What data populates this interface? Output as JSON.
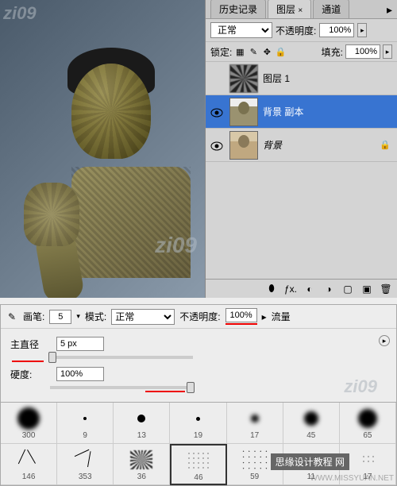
{
  "canvas": {
    "wm_top": "zi09",
    "wm_bottom": "zi09"
  },
  "panels": {
    "tabs": {
      "history": "历史记录",
      "layers": "图层",
      "channels": "通道",
      "close": "×"
    }
  },
  "blend": {
    "mode": "正常",
    "opacity_label": "不透明度:",
    "opacity": "100%",
    "arrow": "▸"
  },
  "lock": {
    "label": "锁定:",
    "fill_label": "填充:",
    "fill": "100%"
  },
  "layers": [
    {
      "name": "图层 1",
      "visible": false,
      "locked": false
    },
    {
      "name": "背景 副本",
      "visible": true,
      "locked": false
    },
    {
      "name": "背景",
      "visible": true,
      "locked": true
    }
  ],
  "brush_bar": {
    "brush_label": "画笔:",
    "brush_size": "5",
    "mode_label": "模式:",
    "mode": "正常",
    "opacity_label": "不透明度:",
    "opacity": "100%",
    "flow_label": "流量",
    "arrow": "▸"
  },
  "brush_ctrl": {
    "diameter_label": "主直径",
    "diameter": "5 px",
    "hardness_label": "硬度:",
    "hardness": "100%",
    "wm": "zi09"
  },
  "brushes_row1": [
    "300",
    "9",
    "13",
    "19",
    "17",
    "45",
    "65"
  ],
  "brushes_row2": [
    "146",
    "353",
    "36",
    "46",
    "59",
    "11",
    "17"
  ],
  "footer": {
    "site": "WWW.MISSYUAN.NET",
    "label": "思缘设计教程 网"
  }
}
